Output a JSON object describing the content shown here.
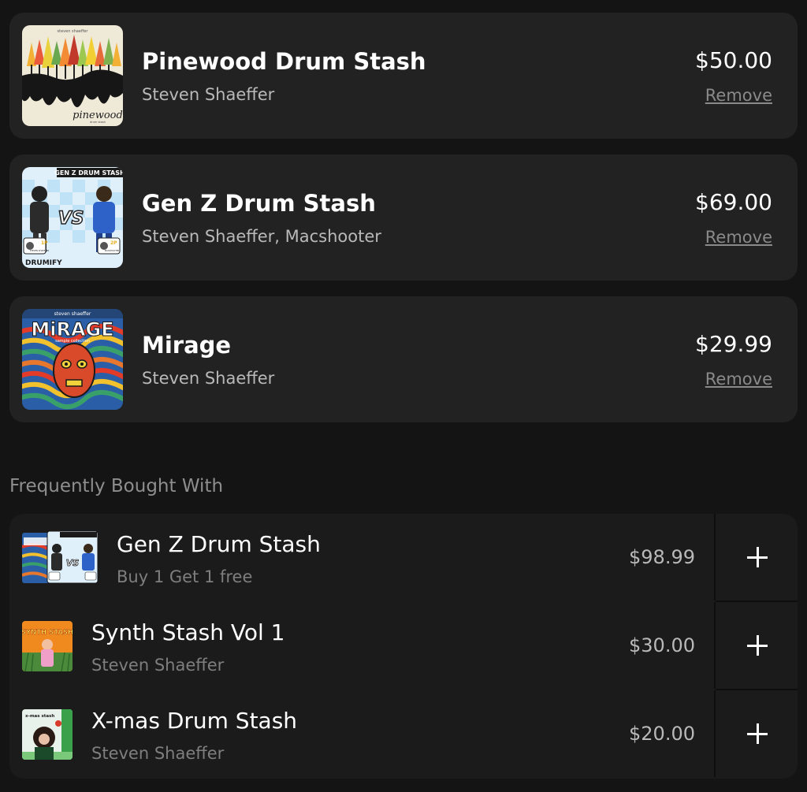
{
  "cart": {
    "items": [
      {
        "title": "Pinewood Drum Stash",
        "artist": "Steven Shaeffer",
        "price": "$50.00",
        "remove_label": "Remove",
        "cover_text": "pinewood",
        "cover_caption": "steven shaeffer",
        "cover_small": "drum stash"
      },
      {
        "title": "Gen Z Drum Stash",
        "artist": "Steven Shaeffer, Macshooter",
        "price": "$69.00",
        "remove_label": "Remove",
        "cover_text": "GEN Z DRUM STASH",
        "cover_vs": "VS",
        "cover_brand": "DRUMIFY",
        "cover_p1": "1P",
        "cover_p2": "2P",
        "cover_n1": "STEVEN SHAEFFER",
        "cover_n2": "MACSHOOTER"
      },
      {
        "title": "Mirage",
        "artist": "Steven Shaeffer",
        "price": "$29.99",
        "remove_label": "Remove",
        "cover_text": "MiRAGE",
        "cover_caption": "steven shaeffer",
        "cover_sub": "sample collection"
      }
    ]
  },
  "frequently_bought": {
    "heading": "Frequently Bought With",
    "items": [
      {
        "title": "Gen Z Drum Stash",
        "subtitle": "Buy 1 Get 1 free",
        "price": "$98.99",
        "add_label": "+"
      },
      {
        "title": "Synth Stash Vol 1",
        "subtitle": "Steven Shaeffer",
        "price": "$30.00",
        "add_label": "+",
        "cover_text": "SYNTH STASH"
      },
      {
        "title": "X-mas Drum Stash",
        "subtitle": "Steven Shaeffer",
        "price": "$20.00",
        "add_label": "+",
        "cover_text": "x-mas stash"
      }
    ]
  },
  "colors": {
    "background": "#141414",
    "card": "#222222",
    "panel": "#1b1b1b",
    "muted_text": "#b9b9b9",
    "link": "#8a8a8a"
  }
}
